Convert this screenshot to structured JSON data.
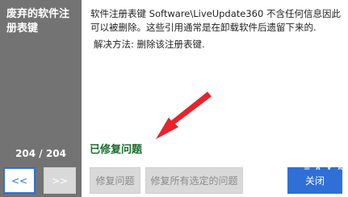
{
  "sidebar": {
    "title": "废弃的软件注册表键",
    "counter": "204 / 204",
    "prev_label": "<<",
    "next_label": ">>"
  },
  "main": {
    "description": "软件注册表键 Software\\LiveUpdate360 不含任何信息因此可以被删除。这些引用通常是在卸载软件后遗留下来的.",
    "solution": "解决方法: 删除该注册表键.",
    "status": "已修复问题"
  },
  "buttons": {
    "fix": "修复问题",
    "fix_all": "修复所有选定的问题",
    "close": "关闭"
  },
  "colors": {
    "sidebar": "#737373",
    "accent": "#2f6fd6",
    "status": "#1b6b2e",
    "arrow": "#e8232a"
  }
}
